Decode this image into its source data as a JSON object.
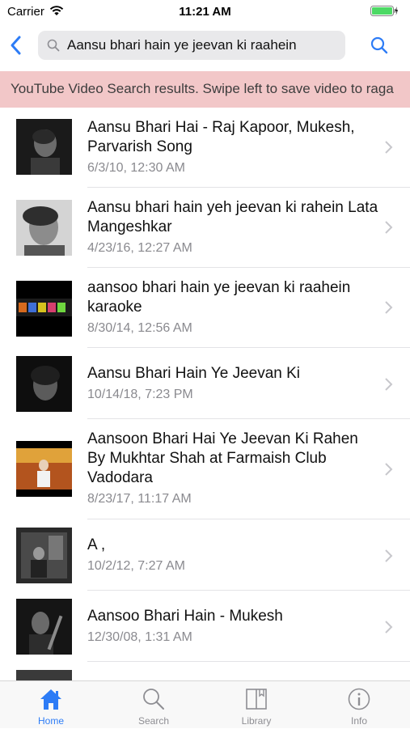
{
  "status_bar": {
    "carrier": "Carrier",
    "time": "11:21 AM"
  },
  "search": {
    "query": "Aansu bhari hain ye jeevan ki raahein"
  },
  "banner": {
    "text": "YouTube Video Search results. Swipe left to save video to raga"
  },
  "results": [
    {
      "title": "Aansu Bhari Hai - Raj Kapoor, Mukesh, Parvarish Song",
      "date": "6/3/10, 12:30 AM"
    },
    {
      "title": "Aansu bhari hain yeh jeevan ki rahein Lata Mangeshkar",
      "date": "4/23/16, 12:27 AM"
    },
    {
      "title": "aansoo bhari hain ye jeevan ki raahein karaoke",
      "date": "8/30/14, 12:56 AM"
    },
    {
      "title": "Aansu Bhari Hain Ye Jeevan Ki",
      "date": "10/14/18, 7:23 PM"
    },
    {
      "title": "Aansoon Bhari Hai Ye Jeevan Ki Rahen By Mukhtar Shah at Farmaish Club Vadodara",
      "date": "8/23/17, 11:17 AM"
    },
    {
      "title": "A                                  ,",
      "date": "10/2/12, 7:27 AM"
    },
    {
      "title": "Aansoo Bhari Hain - Mukesh",
      "date": "12/30/08, 1:31 AM"
    }
  ],
  "tabs": [
    {
      "label": "Home",
      "icon": "home-icon",
      "active": true
    },
    {
      "label": "Search",
      "icon": "search-icon",
      "active": false
    },
    {
      "label": "Library",
      "icon": "library-icon",
      "active": false
    },
    {
      "label": "Info",
      "icon": "info-icon",
      "active": false
    }
  ],
  "colors": {
    "accent": "#2d7cf6",
    "banner_bg": "#f2c7c8",
    "secondary_text": "#8a8a8f"
  }
}
